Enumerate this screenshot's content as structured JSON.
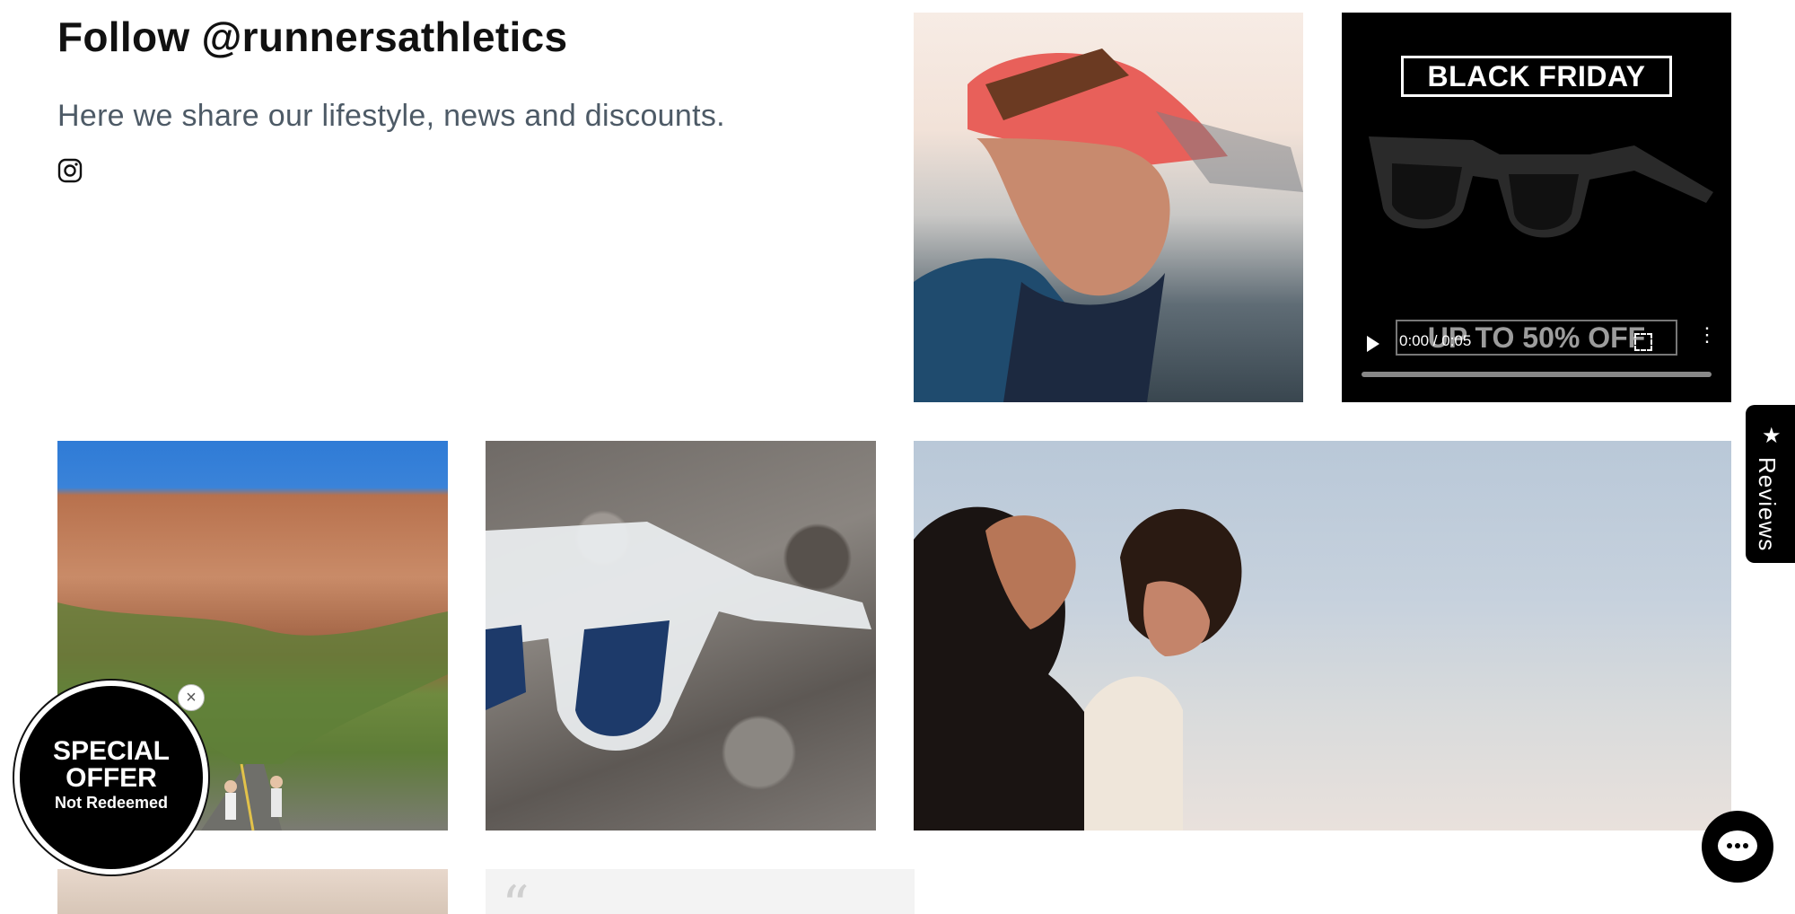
{
  "header": {
    "title": "Follow @runnersathletics",
    "subtitle": "Here we share our lifestyle, news and discounts."
  },
  "instagram_icon": "instagram-icon",
  "gallery": {
    "black_friday": {
      "headline": "BLACK FRIDAY",
      "offer": "UP TO 50% OFF",
      "video_time": "0:00 / 0:05"
    },
    "quote_mark": "“"
  },
  "reviews_tab": {
    "label": "Reviews",
    "icon": "star-icon"
  },
  "special_offer": {
    "line1": "SPECIAL",
    "line2": "OFFER",
    "line3": "Not Redeemed",
    "close": "×"
  },
  "chat": {
    "icon": "chat-icon"
  }
}
